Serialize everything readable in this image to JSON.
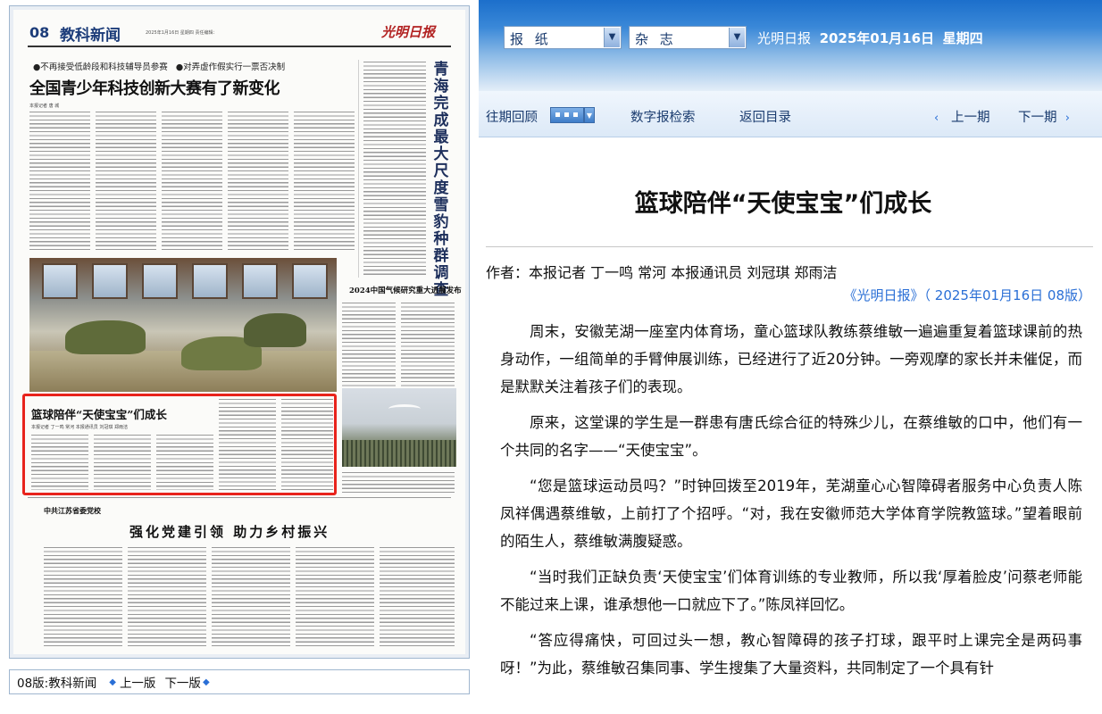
{
  "paper": {
    "page_no": "08",
    "section": "教科新闻",
    "date_line": "2025年1月16日 星期四 责任编辑：",
    "masthead": "光明日报",
    "subheads": [
      "●不再接受低龄段和科技辅导员参赛",
      "●对弄虚作假实行一票否决制"
    ],
    "headline": "全国青少年科技创新大赛有了新变化",
    "byline": "本报记者 唐 城",
    "vertical_headline": "青海完成最大尺度雪豹种群调查",
    "weather_headline": "2024中国气候研究重大进展发布",
    "basketball_headline": "篮球陪伴“天使宝宝”们成长",
    "basketball_byline": "本报记者 丁一鸣 常河 本报通讯员 刘冠琪 郑雨洁",
    "party_label": "中共江苏省委党校",
    "party_headline": "强化党建引领 助力乡村振兴"
  },
  "pager": {
    "current": "08版:教科新闻",
    "prev": "上一版",
    "next": "下一版"
  },
  "topbar": {
    "select_newspaper": "报 纸",
    "select_magazine": "杂 志",
    "paper_name": "光明日报",
    "date": "2025年01月16日",
    "weekday": "星期四"
  },
  "nav": {
    "archive": "往期回顾",
    "search": "数字报检索",
    "toc": "返回目录",
    "prev_issue": "上一期",
    "next_issue": "下一期"
  },
  "article": {
    "title": "篮球陪伴“天使宝宝”们成长",
    "author": "作者：本报记者 丁一鸣 常河 本报通讯员 刘冠琪 郑雨洁",
    "source": "《光明日报》（ 2025年01月16日 08版）",
    "paragraphs": [
      "周末，安徽芜湖一座室内体育场，童心篮球队教练蔡维敏一遍遍重复着篮球课前的热身动作，一组简单的手臂伸展训练，已经进行了近20分钟。一旁观摩的家长并未催促，而是默默关注着孩子们的表现。",
      "原来，这堂课的学生是一群患有唐氏综合征的特殊少儿，在蔡维敏的口中，他们有一个共同的名字——“天使宝宝”。",
      "“您是篮球运动员吗？”时钟回拨至2019年，芜湖童心心智障碍者服务中心负责人陈凤祥偶遇蔡维敏，上前打了个招呼。“对，我在安徽师范大学体育学院教篮球。”望着眼前的陌生人，蔡维敏满腹疑惑。",
      "“当时我们正缺负责‘天使宝宝’们体育训练的专业教师，所以我‘厚着脸皮’问蔡老师能不能过来上课，谁承想他一口就应下了。”陈凤祥回忆。",
      "“答应得痛快，可回过头一想，教心智障碍的孩子打球，跟平时上课完全是两码事呀！”为此，蔡维敏召集同事、学生搜集了大量资料，共同制定了一个具有针"
    ]
  }
}
